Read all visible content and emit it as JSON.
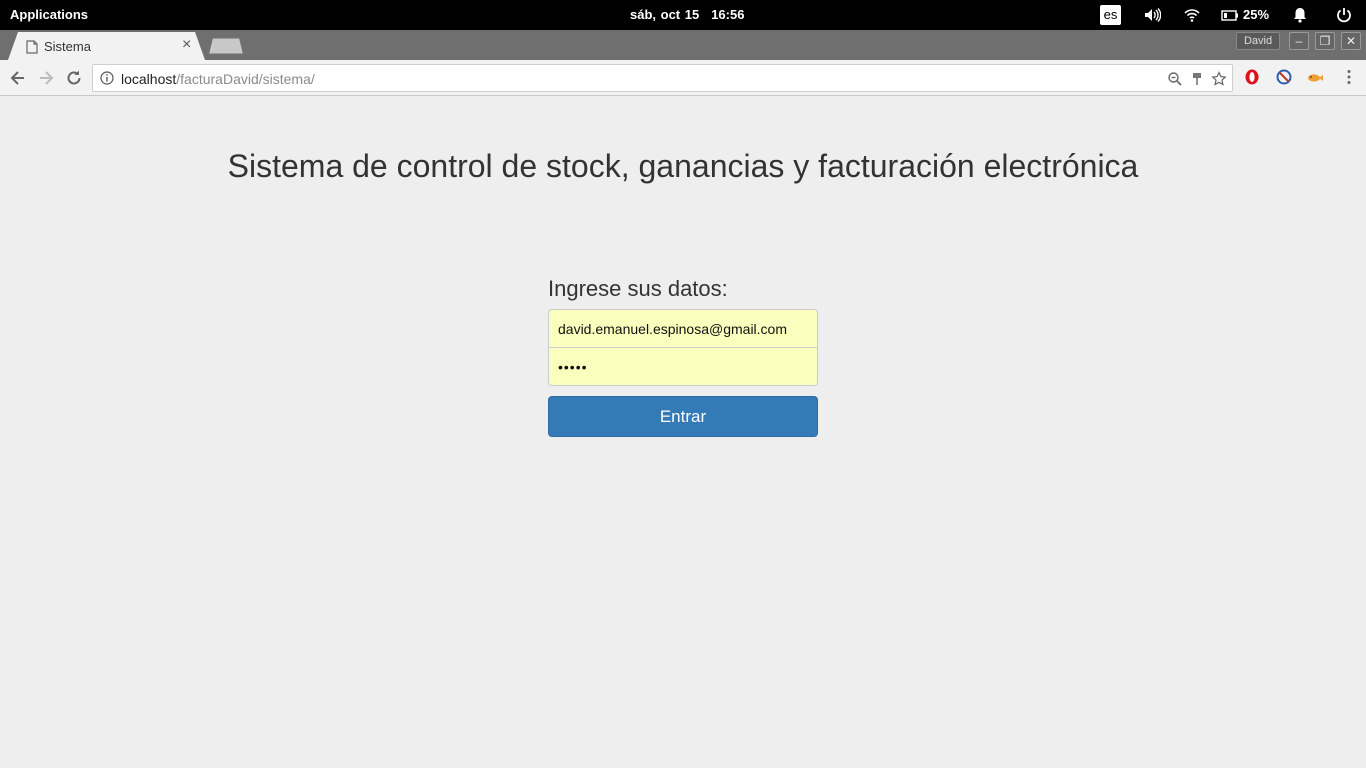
{
  "system_panel": {
    "applications_label": "Applications",
    "date": "sáb, oct 15",
    "time": "16:56",
    "keyboard_layout": "es",
    "battery_percent": "25%"
  },
  "browser": {
    "tab": {
      "title": "Sistema",
      "close_glyph": "×"
    },
    "profile_name": "David",
    "window_buttons": {
      "minimize": "–",
      "restore": "❐",
      "close": "✕"
    },
    "url": {
      "host": "localhost",
      "path": "/facturaDavid/sistema/"
    }
  },
  "page": {
    "title": "Sistema de control de stock, ganancias y facturación electrónica",
    "form": {
      "legend": "Ingrese sus datos:",
      "email_value": "david.emanuel.espinosa@gmail.com",
      "password_value": "•••••",
      "submit_label": "Entrar"
    }
  },
  "colors": {
    "primary_button": "#337ab7",
    "autofill_background": "#faffbd",
    "page_background": "#eeeeee"
  },
  "icons": [
    "back-arrow-icon",
    "forward-arrow-icon",
    "reload-icon",
    "info-icon",
    "zoom-icon",
    "pin-icon",
    "star-icon",
    "opera-extension-icon",
    "block-extension-icon",
    "fish-extension-icon",
    "menu-dots-icon",
    "volume-icon",
    "wifi-icon",
    "battery-icon",
    "bell-icon",
    "power-icon",
    "document-icon"
  ]
}
